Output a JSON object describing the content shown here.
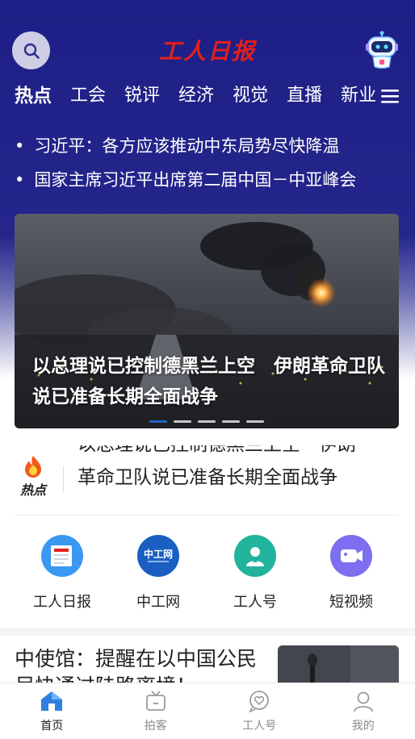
{
  "header": {
    "logo_text": "工人日报",
    "search_icon": "search-icon",
    "assistant_icon": "robot-icon"
  },
  "tabs": [
    {
      "label": "热点",
      "active": true
    },
    {
      "label": "工会"
    },
    {
      "label": "锐评"
    },
    {
      "label": "经济"
    },
    {
      "label": "视觉"
    },
    {
      "label": "直播"
    },
    {
      "label": "新业"
    }
  ],
  "headlines": [
    "习近平：各方应该推动中东局势尽快降温",
    "国家主席习近平出席第二届中国－中亚峰会"
  ],
  "banner": {
    "title": "以总理说已控制德黑兰上空　伊朗革命卫队说已准备长期全面战争",
    "slide_count": 5,
    "active_index": 0
  },
  "hot": {
    "logo_label": "热点",
    "ghost_text": "以总理说已控制德黑兰上空　伊朗",
    "text": "革命卫队说已准备长期全面战争"
  },
  "quick_links": [
    {
      "label": "工人日报",
      "icon": "newspaper-icon",
      "color": "#2f8ff0"
    },
    {
      "label": "中工网",
      "icon": "zhonggongwang-icon",
      "color": "#1f5fc0"
    },
    {
      "label": "工人号",
      "icon": "worker-account-icon",
      "color": "#23b3a0"
    },
    {
      "label": "短视频",
      "icon": "video-camera-icon",
      "color": "#7a6df0"
    }
  ],
  "news": {
    "title": "中使馆：提醒在以中国公民尽快通过陆路离境！"
  },
  "bottom_nav": [
    {
      "label": "首页",
      "icon": "home-icon",
      "active": true
    },
    {
      "label": "拍客",
      "icon": "tv-icon"
    },
    {
      "label": "工人号",
      "icon": "heart-chat-icon"
    },
    {
      "label": "我的",
      "icon": "user-icon"
    }
  ],
  "colors": {
    "header_blue": "#1e1f86",
    "logo_red": "#e0201c",
    "active_dot": "#2563c8",
    "nav_active": "#2f80e0"
  }
}
